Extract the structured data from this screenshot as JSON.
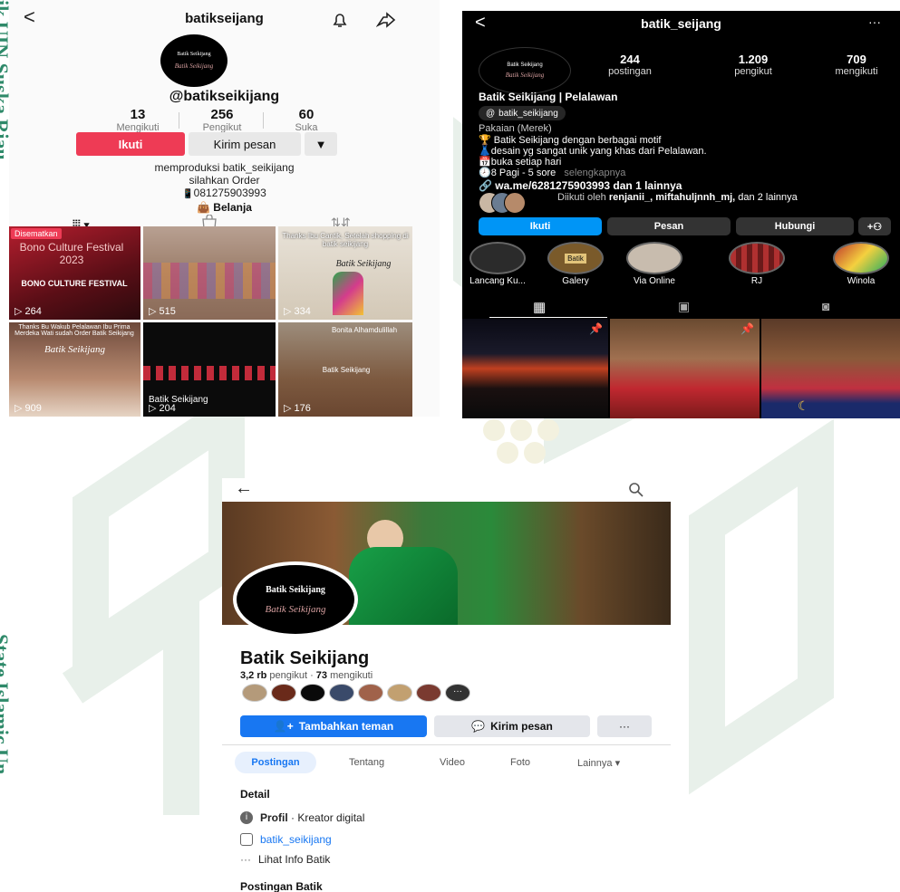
{
  "side_watermark": {
    "top_text": "ik UIN Suska Riau",
    "bottom_text": "State Islamic Un"
  },
  "tiktok": {
    "username": "batikseijang",
    "handle": "@batikseikijang",
    "stats": [
      {
        "value": "13",
        "label": "Mengikuti"
      },
      {
        "value": "256",
        "label": "Pengikut"
      },
      {
        "value": "60",
        "label": "Suka"
      }
    ],
    "follow_label": "Ikuti",
    "message_label": "Kirim pesan",
    "bio_line1": "memproduksi batik_seikijang",
    "bio_line2": "silahkan Order",
    "bio_phone": "081275903993",
    "shop_label": "Belanja",
    "logo_text": "Batik Seikijang",
    "videos": [
      {
        "badge": "Disematkan",
        "caption": "Bono Culture Festival 2023",
        "sub": "BONO CULTURE FESTIVAL",
        "views": "264"
      },
      {
        "caption": "",
        "views": "515"
      },
      {
        "caption": "Thanks Ibu Cantik, Setelah shopping di batik seikijang",
        "sub": "Batik Seikijang",
        "views": "334"
      },
      {
        "caption": "Thanks Bu Wakub Pelalawan Ibu Prima Merdeka Wati sudah Order Batik Seikijang",
        "sub": "Batik Seikijang",
        "views": "909"
      },
      {
        "caption": "Batik Seikijang",
        "views": "204"
      },
      {
        "caption": "Bonita Alhamdulillah",
        "sub": "Batik Seikijang",
        "views": "176"
      }
    ]
  },
  "instagram": {
    "username": "batik_seijang",
    "stats": [
      {
        "value": "244",
        "label": "postingan"
      },
      {
        "value": "1.209",
        "label": "pengikut"
      },
      {
        "value": "709",
        "label": "mengikuti"
      }
    ],
    "name": "Batik Seikijang | Pelalawan",
    "threads_handle": "batik_seikijang",
    "category": "Pakaian (Merek)",
    "bio_lines": [
      "Batik Seikijang dengan berbagai motif",
      "desain yg sangat unik yang khas dari Pelalawan.",
      "buka setiap hari",
      "8 Pagi - 5 sore"
    ],
    "more_label": "selengkapnya",
    "link": "wa.me/6281275903993 dan 1 lainnya",
    "followed_by_prefix": "Diikuti oleh",
    "followed_by_names": "renjanii_, miftahuljnnh_mj,",
    "followed_by_suffix": "dan 2 lainnya",
    "buttons": {
      "follow": "Ikuti",
      "message": "Pesan",
      "contact": "Hubungi"
    },
    "highlights": [
      "Lancang Ku...",
      "Galery",
      "Via Online",
      "RJ",
      "Winola"
    ],
    "logo_text": "Batik Seikijang",
    "highlight_tag": "Batik"
  },
  "facebook": {
    "name": "Batik Seikijang",
    "followers_value": "3,2 rb",
    "followers_label": "pengikut",
    "following_value": "73",
    "following_label": "mengikuti",
    "add_friend_label": "Tambahkan teman",
    "message_label": "Kirim pesan",
    "more_label": "···",
    "tabs": [
      "Postingan",
      "Tentang",
      "Video",
      "Foto",
      "Lainnya"
    ],
    "detail_heading": "Detail",
    "profile_label": "Profil",
    "profile_value": "· Kreator digital",
    "instagram_link": "batik_seikijang",
    "info_label": "Lihat Info Batik",
    "posts_heading": "Postingan Batik",
    "logo_text": "Batik Seikijang",
    "logo_script": "Batik Seikijang"
  },
  "colors": {
    "tiktok_red": "#ee3b55",
    "instagram_blue": "#0095f6",
    "facebook_blue": "#1877f2",
    "facebook_tab_bg": "#e7f0fd",
    "watermark_green": "#2f8a6a"
  }
}
